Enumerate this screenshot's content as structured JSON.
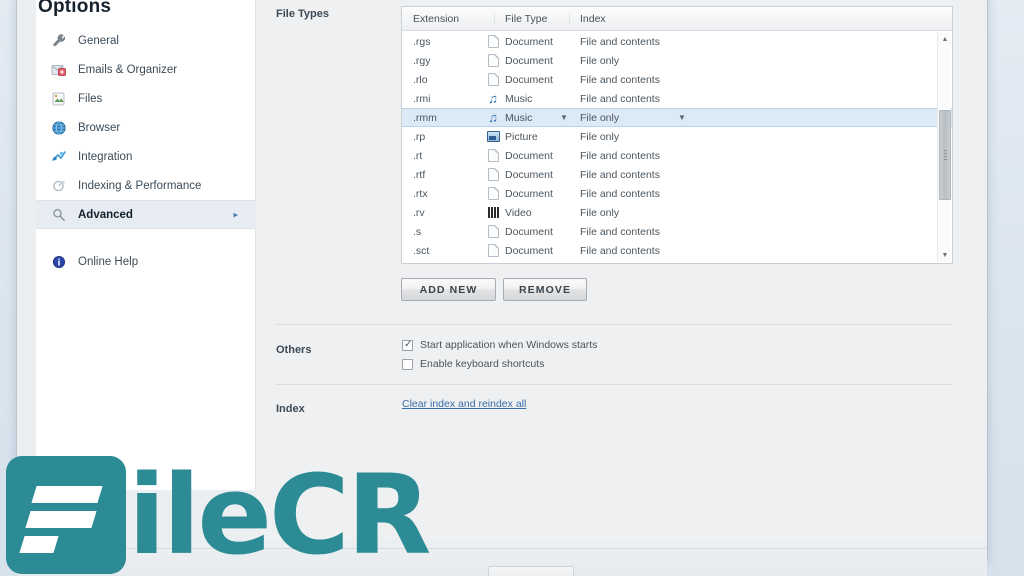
{
  "sidebar": {
    "title": "Options",
    "items": [
      {
        "label": "General",
        "icon": "wrench-icon",
        "selected": false
      },
      {
        "label": "Emails & Organizer",
        "icon": "mail-icon",
        "selected": false
      },
      {
        "label": "Files",
        "icon": "files-icon",
        "selected": false
      },
      {
        "label": "Browser",
        "icon": "globe-icon",
        "selected": false
      },
      {
        "label": "Integration",
        "icon": "integration-icon",
        "selected": false
      },
      {
        "label": "Indexing & Performance",
        "icon": "indexing-icon",
        "selected": false
      },
      {
        "label": "Advanced",
        "icon": "magnifier-icon",
        "selected": true
      }
    ],
    "help": {
      "label": "Online Help",
      "icon": "info-icon"
    },
    "selected_chevron": "▸"
  },
  "sections": {
    "file_types_label": "File Types",
    "others_label": "Others",
    "index_label": "Index"
  },
  "file_types": {
    "columns": [
      "Extension",
      "File Type",
      "Index"
    ],
    "rows": [
      {
        "extension": ".rgs",
        "type": "Document",
        "icon": "document-icon",
        "index": "File and contents",
        "selected": false
      },
      {
        "extension": ".rgy",
        "type": "Document",
        "icon": "document-icon",
        "index": "File only",
        "selected": false
      },
      {
        "extension": ".rlo",
        "type": "Document",
        "icon": "document-icon",
        "index": "File and contents",
        "selected": false
      },
      {
        "extension": ".rmi",
        "type": "Music",
        "icon": "music-icon",
        "index": "File and contents",
        "selected": false
      },
      {
        "extension": ".rmm",
        "type": "Music",
        "icon": "music-icon",
        "index": "File only",
        "selected": true
      },
      {
        "extension": ".rp",
        "type": "Picture",
        "icon": "picture-icon",
        "index": "File only",
        "selected": false
      },
      {
        "extension": ".rt",
        "type": "Document",
        "icon": "document-icon",
        "index": "File and contents",
        "selected": false
      },
      {
        "extension": ".rtf",
        "type": "Document",
        "icon": "document-icon",
        "index": "File and contents",
        "selected": false
      },
      {
        "extension": ".rtx",
        "type": "Document",
        "icon": "document-icon",
        "index": "File and contents",
        "selected": false
      },
      {
        "extension": ".rv",
        "type": "Video",
        "icon": "video-icon",
        "index": "File only",
        "selected": false
      },
      {
        "extension": ".s",
        "type": "Document",
        "icon": "document-icon",
        "index": "File and contents",
        "selected": false
      },
      {
        "extension": ".sct",
        "type": "Document",
        "icon": "document-icon",
        "index": "File and contents",
        "selected": false
      }
    ],
    "dropdown_caret": "▼",
    "scrollbar": {
      "up_arrow": "▲",
      "down_arrow": "▼"
    }
  },
  "buttons": {
    "add_new": "ADD NEW",
    "remove": "REMOVE"
  },
  "others": {
    "start_with_windows": {
      "label": "Start application when Windows starts",
      "checked": true
    },
    "keyboard_shortcuts": {
      "label": "Enable keyboard shortcuts",
      "checked": false
    }
  },
  "index": {
    "clear_link": "Clear index and reindex all"
  },
  "watermark": {
    "text": "ileCR"
  },
  "colors": {
    "accent": "#2c8b95",
    "selection": "#dce9f7",
    "link": "#3a6ea8",
    "panel": "#eef0f1"
  }
}
